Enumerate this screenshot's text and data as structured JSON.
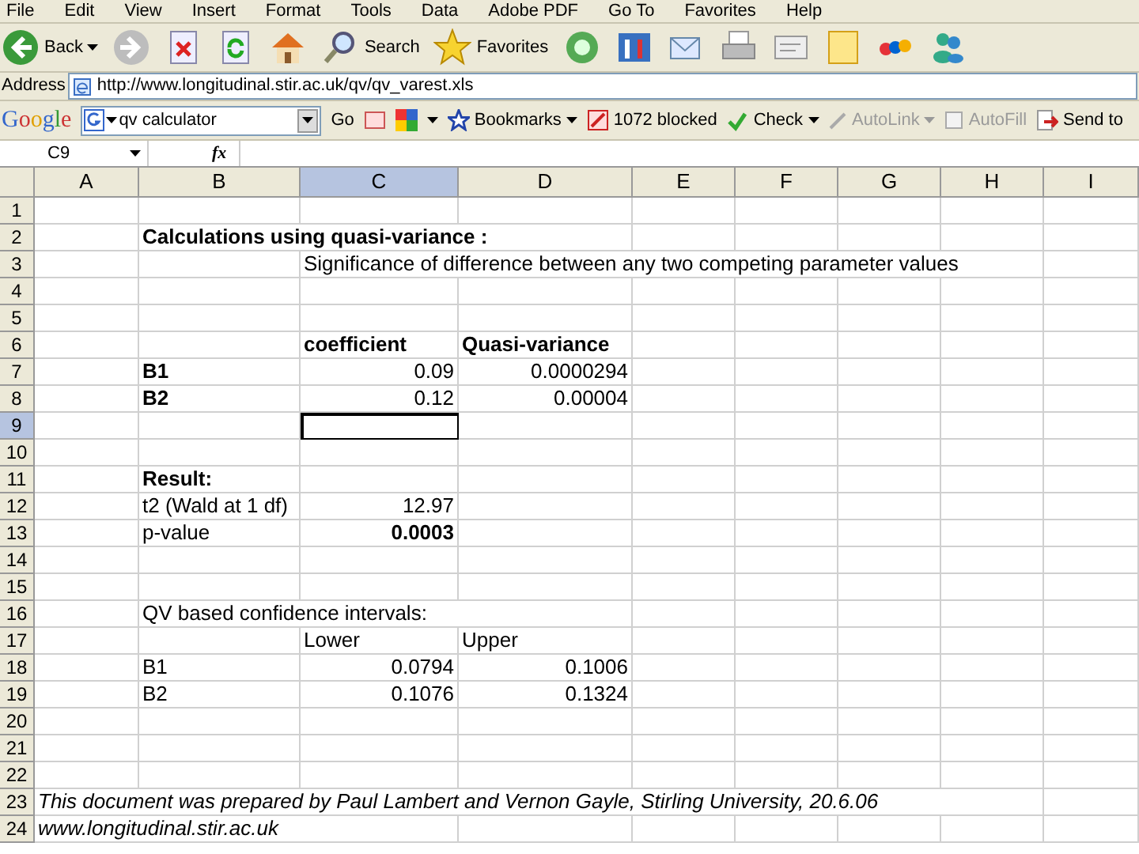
{
  "menu_bar": [
    "File",
    "Edit",
    "View",
    "Insert",
    "Format",
    "Tools",
    "Data",
    "Adobe PDF",
    "Go To",
    "Favorites",
    "Help"
  ],
  "toolbar": [
    {
      "kind": "back",
      "label": "Back"
    },
    {
      "kind": "forward"
    },
    {
      "kind": "stop"
    },
    {
      "kind": "refresh"
    },
    {
      "kind": "home"
    },
    {
      "kind": "search",
      "label": "Search"
    },
    {
      "kind": "favorites",
      "label": "Favorites"
    },
    {
      "kind": "media"
    },
    {
      "kind": "tools"
    },
    {
      "kind": "mail"
    },
    {
      "kind": "print"
    },
    {
      "kind": "edit"
    },
    {
      "kind": "note"
    },
    {
      "kind": "ebay"
    },
    {
      "kind": "messenger"
    }
  ],
  "address_bar": {
    "label": "Address",
    "value": "http://www.longitudinal.stir.ac.uk/qv/qv_varest.xls"
  },
  "google_bar": {
    "logo": "Google",
    "search_value": "qv calculator",
    "go": "Go",
    "bookmarks": "Bookmarks",
    "blocked": "1072 blocked",
    "check": "Check",
    "autolink": "AutoLink",
    "autofill": "AutoFill",
    "send": "Send to"
  },
  "formula_bar": {
    "name_box": "C9",
    "fx": "fx"
  },
  "columns": [
    {
      "label": "A",
      "selected": false
    },
    {
      "label": "B",
      "selected": false
    },
    {
      "label": "C",
      "selected": true
    },
    {
      "label": "D",
      "selected": false
    },
    {
      "label": "E",
      "selected": false
    },
    {
      "label": "F",
      "selected": false
    },
    {
      "label": "G",
      "selected": false
    },
    {
      "label": "H",
      "selected": false
    },
    {
      "label": "I",
      "selected": false
    }
  ],
  "rows": [
    {
      "label": "1",
      "selected": false,
      "cells": {}
    },
    {
      "label": "2",
      "selected": false,
      "cells": {
        "col_b": {
          "text": "Calculations using quasi-variance :",
          "bold": true,
          "italic": false,
          "kind": "text"
        }
      }
    },
    {
      "label": "3",
      "selected": false,
      "cells": {
        "col_c": {
          "text": "Significance of difference between any two competing parameter values",
          "bold": false,
          "italic": false,
          "kind": "text"
        }
      }
    },
    {
      "label": "4",
      "selected": false,
      "cells": {}
    },
    {
      "label": "5",
      "selected": false,
      "cells": {}
    },
    {
      "label": "6",
      "selected": false,
      "cells": {
        "col_c": {
          "text": "coefficient",
          "bold": true,
          "italic": false,
          "kind": "text"
        },
        "col_d": {
          "text": "Quasi-variance",
          "bold": true,
          "italic": false,
          "kind": "text"
        }
      }
    },
    {
      "label": "7",
      "selected": false,
      "cells": {
        "col_b": {
          "text": "B1",
          "bold": true,
          "italic": false,
          "kind": "text"
        },
        "col_c": {
          "text": "0.09",
          "bold": false,
          "italic": false,
          "kind": "number"
        },
        "col_d": {
          "text": "0.0000294",
          "bold": false,
          "italic": false,
          "kind": "number"
        }
      }
    },
    {
      "label": "8",
      "selected": false,
      "cells": {
        "col_b": {
          "text": "B2",
          "bold": true,
          "italic": false,
          "kind": "text"
        },
        "col_c": {
          "text": "0.12",
          "bold": false,
          "italic": false,
          "kind": "number"
        },
        "col_d": {
          "text": "0.00004",
          "bold": false,
          "italic": false,
          "kind": "number"
        }
      }
    },
    {
      "label": "9",
      "selected": true,
      "cells": {}
    },
    {
      "label": "10",
      "selected": false,
      "cells": {}
    },
    {
      "label": "11",
      "selected": false,
      "cells": {
        "col_b": {
          "text": "Result:",
          "bold": true,
          "italic": false,
          "kind": "text"
        }
      }
    },
    {
      "label": "12",
      "selected": false,
      "cells": {
        "col_b": {
          "text": "t2 (Wald at 1 df)",
          "bold": false,
          "italic": false,
          "kind": "text"
        },
        "col_c": {
          "text": "12.97",
          "bold": false,
          "italic": false,
          "kind": "number"
        }
      }
    },
    {
      "label": "13",
      "selected": false,
      "cells": {
        "col_b": {
          "text": "p-value",
          "bold": false,
          "italic": false,
          "kind": "text"
        },
        "col_c": {
          "text": "0.0003",
          "bold": true,
          "italic": false,
          "kind": "number"
        }
      }
    },
    {
      "label": "14",
      "selected": false,
      "cells": {}
    },
    {
      "label": "15",
      "selected": false,
      "cells": {}
    },
    {
      "label": "16",
      "selected": false,
      "cells": {
        "col_b": {
          "text": "QV based confidence intervals:",
          "bold": false,
          "italic": false,
          "kind": "text"
        }
      }
    },
    {
      "label": "17",
      "selected": false,
      "cells": {
        "col_c": {
          "text": "Lower",
          "bold": false,
          "italic": false,
          "kind": "text"
        },
        "col_d": {
          "text": "Upper",
          "bold": false,
          "italic": false,
          "kind": "text"
        }
      }
    },
    {
      "label": "18",
      "selected": false,
      "cells": {
        "col_b": {
          "text": "B1",
          "bold": false,
          "italic": false,
          "kind": "text"
        },
        "col_c": {
          "text": "0.0794",
          "bold": false,
          "italic": false,
          "kind": "number"
        },
        "col_d": {
          "text": "0.1006",
          "bold": false,
          "italic": false,
          "kind": "number"
        }
      }
    },
    {
      "label": "19",
      "selected": false,
      "cells": {
        "col_b": {
          "text": "B2",
          "bold": false,
          "italic": false,
          "kind": "text"
        },
        "col_c": {
          "text": "0.1076",
          "bold": false,
          "italic": false,
          "kind": "number"
        },
        "col_d": {
          "text": "0.1324",
          "bold": false,
          "italic": false,
          "kind": "number"
        }
      }
    },
    {
      "label": "20",
      "selected": false,
      "cells": {}
    },
    {
      "label": "21",
      "selected": false,
      "cells": {}
    },
    {
      "label": "22",
      "selected": false,
      "cells": {}
    },
    {
      "label": "23",
      "selected": false,
      "cells": {
        "col_a": {
          "text": "This document was prepared by Paul Lambert and Vernon Gayle, Stirling University, 20.6.06",
          "bold": false,
          "italic": true,
          "kind": "text"
        }
      }
    },
    {
      "label": "24",
      "selected": false,
      "cells": {
        "col_a": {
          "text": "www.longitudinal.stir.ac.uk",
          "bold": false,
          "italic": true,
          "kind": "text"
        }
      }
    }
  ]
}
